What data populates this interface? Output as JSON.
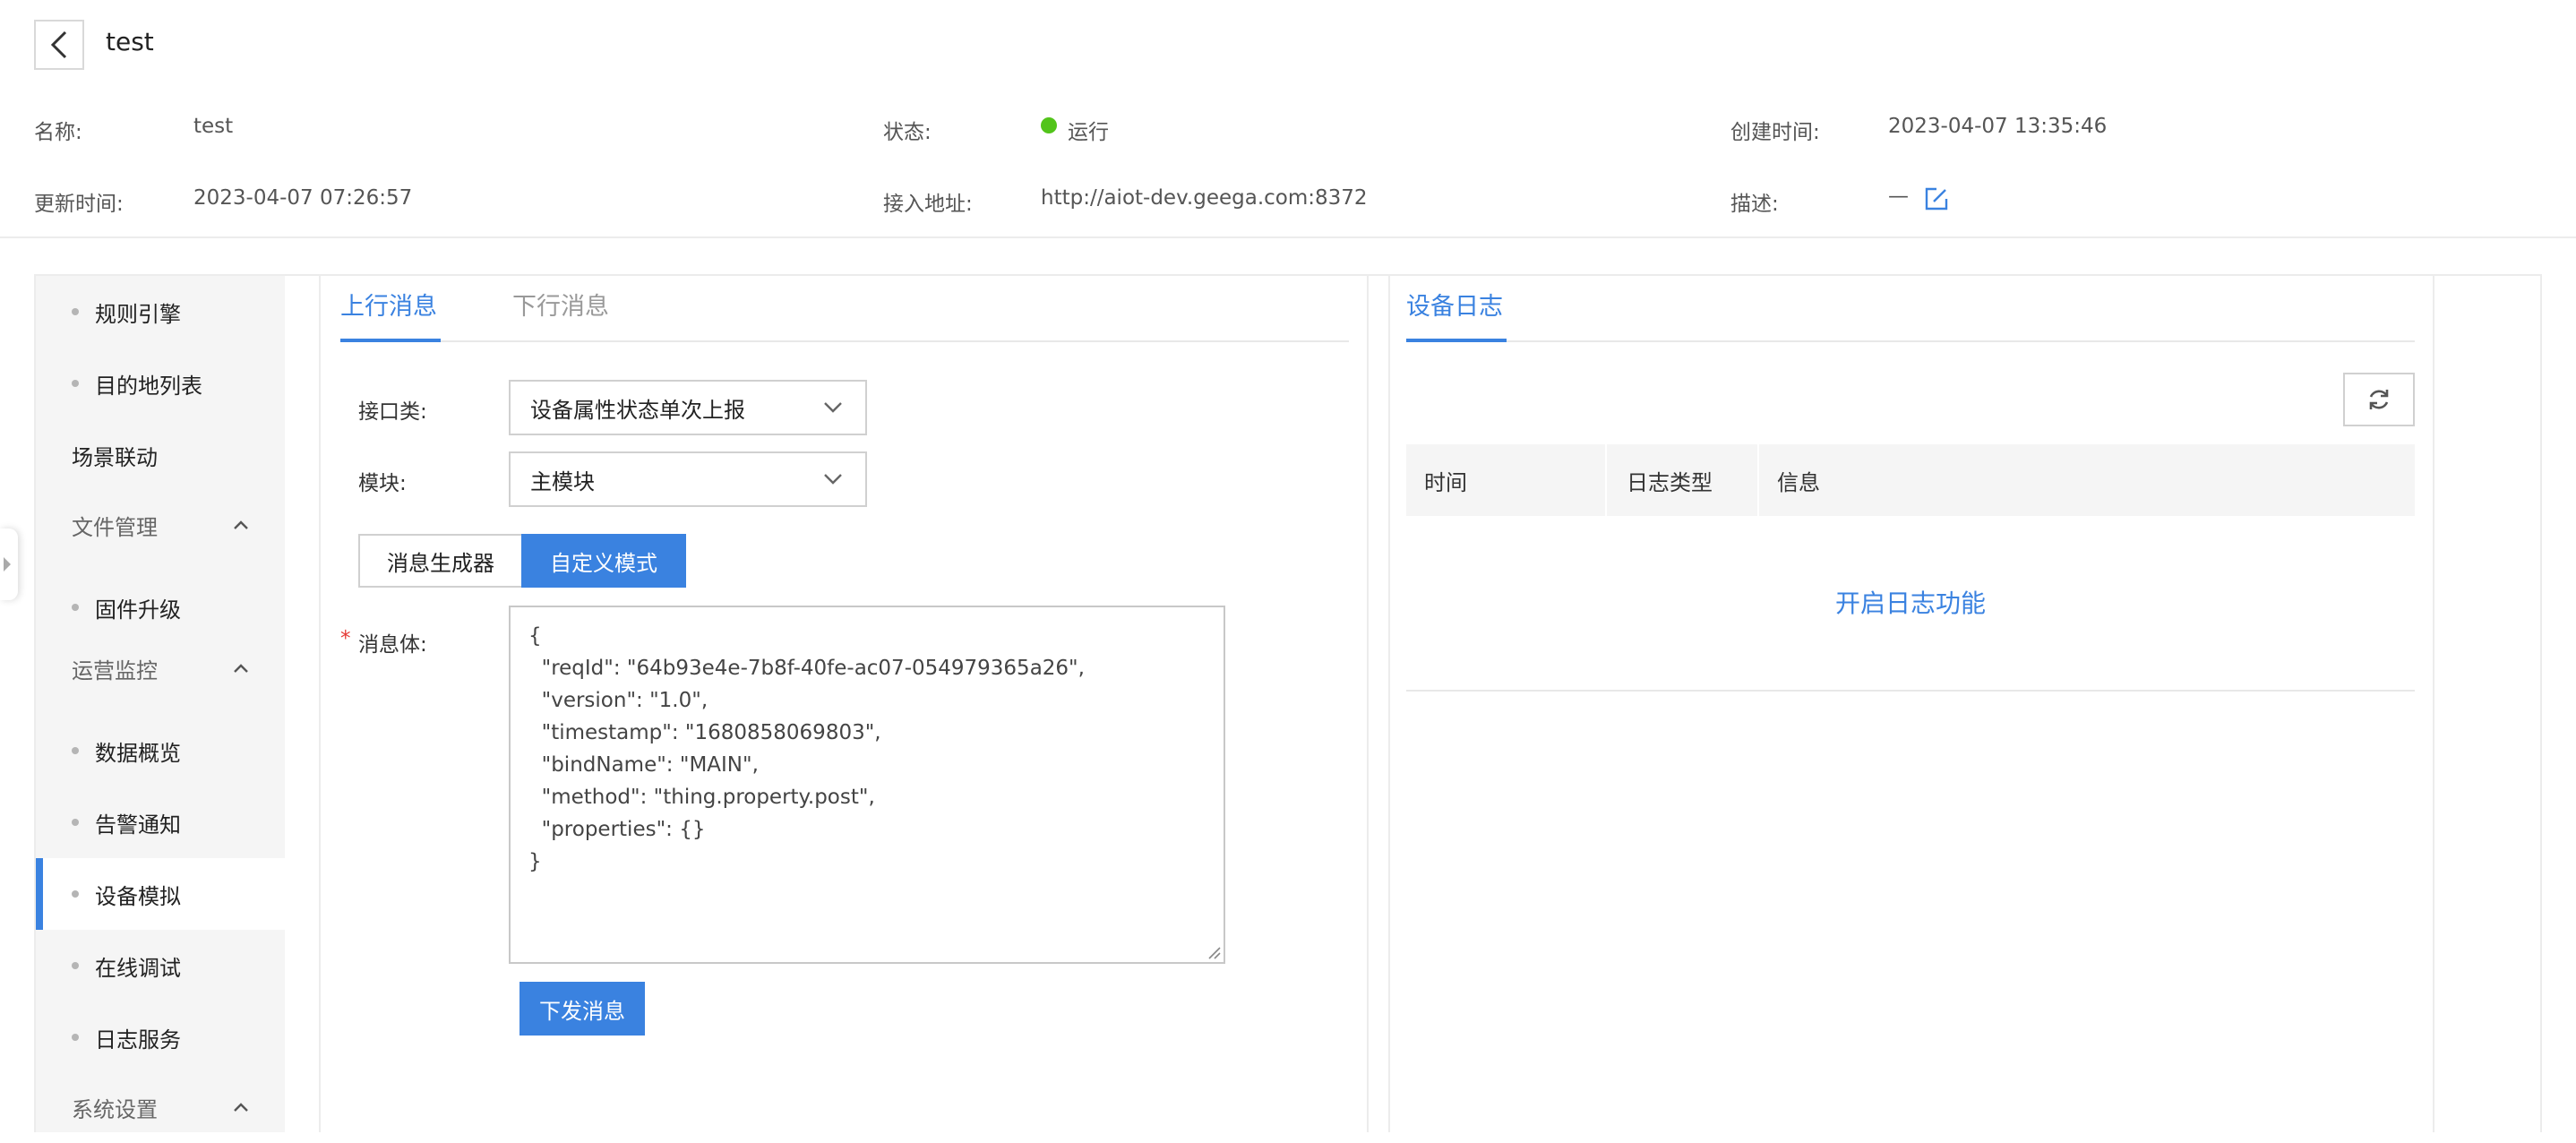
{
  "header": {
    "title": "test",
    "name_label": "名称:",
    "name_value": "test",
    "status_label": "状态:",
    "status_value": "运行",
    "status_color": "#52c41a",
    "created_label": "创建时间:",
    "created_value": "2023-04-07 13:35:46",
    "updated_label": "更新时间:",
    "updated_value": "2023-04-07 07:26:57",
    "address_label": "接入地址:",
    "address_value": "http://aiot-dev.geega.com:8372",
    "desc_label": "描述:",
    "desc_value": "—"
  },
  "sidebar": {
    "items": [
      {
        "label": "规则引擎",
        "kind": "sub"
      },
      {
        "label": "目的地列表",
        "kind": "sub"
      },
      {
        "label": "场景联动",
        "kind": "top"
      },
      {
        "label": "文件管理",
        "kind": "group"
      },
      {
        "label": "固件升级",
        "kind": "sub"
      },
      {
        "label": "运营监控",
        "kind": "group"
      },
      {
        "label": "数据概览",
        "kind": "sub"
      },
      {
        "label": "告警通知",
        "kind": "sub"
      },
      {
        "label": "设备模拟",
        "kind": "sub",
        "active": true
      },
      {
        "label": "在线调试",
        "kind": "sub"
      },
      {
        "label": "日志服务",
        "kind": "sub"
      },
      {
        "label": "系统设置",
        "kind": "group"
      }
    ]
  },
  "upstream": {
    "tab_up": "上行消息",
    "tab_down": "下行消息",
    "interface_label": "接口类:",
    "interface_value": "设备属性状态单次上报",
    "module_label": "模块:",
    "module_value": "主模块",
    "mode_generator": "消息生成器",
    "mode_custom": "自定义模式",
    "required_mark": "*",
    "body_label": "消息体:",
    "body_text": "{\n  \"reqId\": \"64b93e4e-7b8f-40fe-ac07-054979365a26\",\n  \"version\": \"1.0\",\n  \"timestamp\": \"1680858069803\",\n  \"bindName\": \"MAIN\",\n  \"method\": \"thing.property.post\",\n  \"properties\": {}\n}",
    "send_label": "下发消息"
  },
  "device_log": {
    "tab": "设备日志",
    "columns": [
      "时间",
      "日志类型",
      "信息"
    ],
    "enable_label": "开启日志功能"
  },
  "colors": {
    "accent": "#3a82e0",
    "status_running": "#52c41a"
  }
}
